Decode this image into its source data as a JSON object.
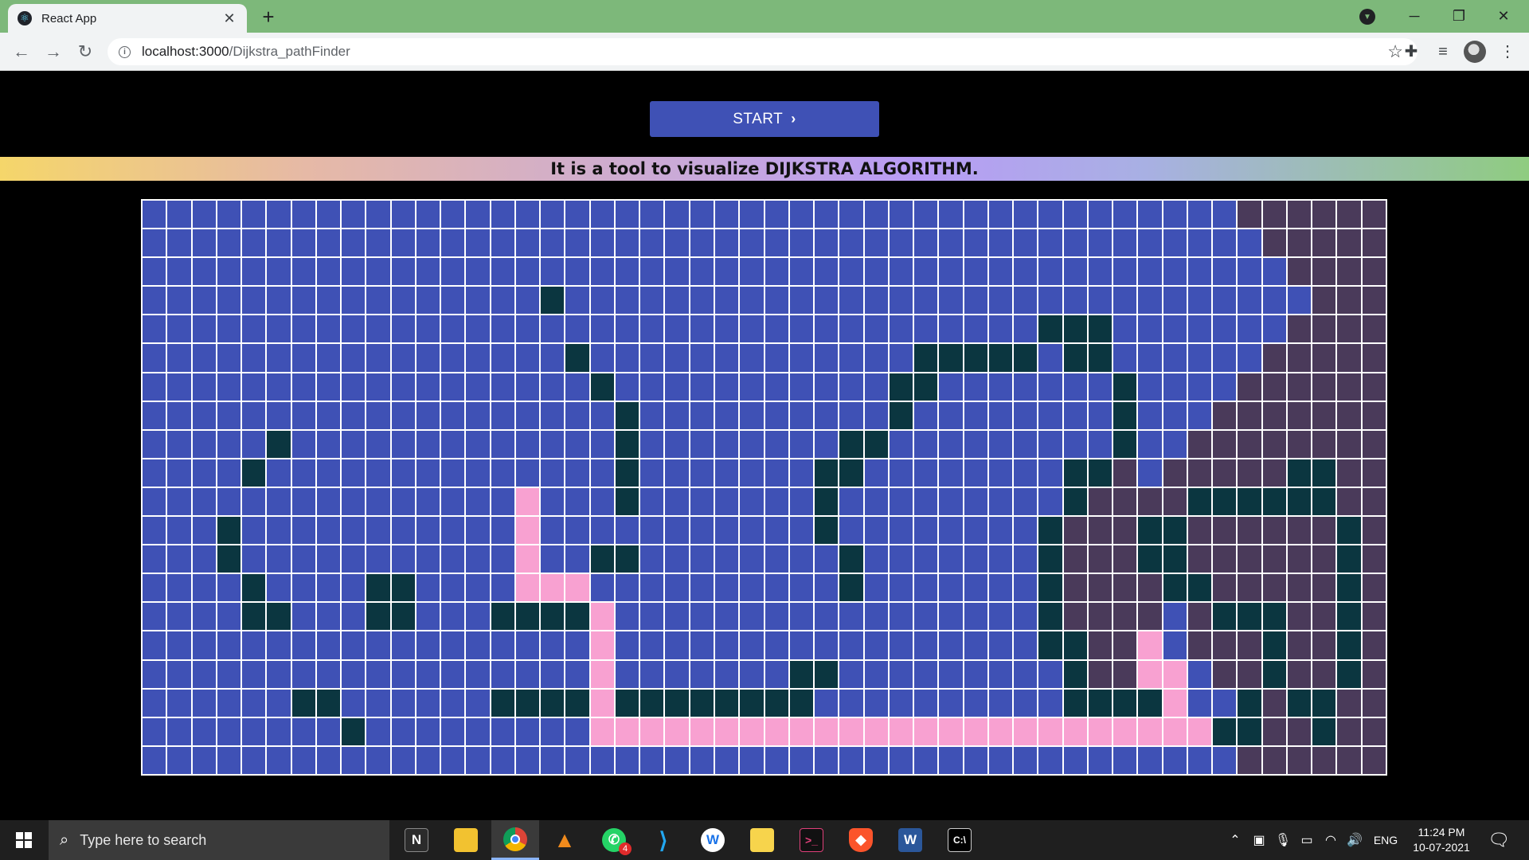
{
  "browser": {
    "tab_title": "React App",
    "url_host": "localhost:3000",
    "url_path": "/Dijkstra_pathFinder"
  },
  "page": {
    "start_label": "START",
    "banner": "It is a tool to visualize DIJKSTRA ALGORITHM."
  },
  "grid": {
    "cols": 50,
    "rows": 20,
    "legend": {
      "U": "unvisited",
      "W": "wall",
      "P": "shortest-path",
      "V": "visited"
    },
    "cells": [
      "UUUUUUUUUUUUUUUUUUUUUUUUUUUUUUUUUUUUUUUUUUUUVVVVVV",
      "UUUUUUUUUUUUUUUUUUUUUUUUUUUUUUUUUUUUUUUUUUUUUVVVVV",
      "UUUUUUUUUUUUUUUUUUUUUUUUUUUUUUUUUUUUUUUUUUUUUUVVVV",
      "UUUUUUUUUUUUUUUUWUUUUUUUUUUUUUUUUUUUUUUUUUUUUUUVVV",
      "UUUUUUUUUUUUUUUUUUUUUUUUUUUUUUUUUUUUWWWUUUUUUUVVVV",
      "UUUUUUUUUUUUUUUUUWUUUUUUUUUUUUUWWWWWUWWUUUUUUVVVVV",
      "UUUUUUUUUUUUUUUUUUWUUUUUUUUUUUWWUUUUUUUWUUUUVVVVVV",
      "UUUUUUUUUUUUUUUUUUUWUUUUUUUUUUWUUUUUUUUWUUUVVVVVVV",
      "UUUUUWUUUUUUUUUUUUUWUUUUUUUUWWUUUUUUUUUWUUVVVVVVVV",
      "UUUUWUUUUUUUUUUUUUUWUUUUUUUWWUUUUUUUUWWVUVVVVVWWVV",
      "UUUUUUUUUUUUUUUPUUUWUUUUUUUWUUUUUUUUUWVVVVWWWWWWVV",
      "UUUWUUUUUUUUUUUPUUUUUUUUUUUWUUUUUUUUWVVVWWVVVVVVWV",
      "UUUWUUUUUUUUUUUPUUWWUUUUUUUUWUUUUUUUWVVVWWVVVVVVWV",
      "UUUUWUUUUWWUUUUPPPUUUUUUUUUUWUUUUUUUWVVVVWWVVVVVWV",
      "UUUUWWUUUWWUUUWWWWPUUUUUUUUUUUUUUUUUWVVVVUVWWWVVWV",
      "UUUUUUUUUUUUUUUUUUPUUUUUUUUUUUUUUUUUWWVVPUVVVWVVWV",
      "UUUUUUUUUUUUUUUUUUPUUUUUUUWWUUUUUUUUUWVVPPUVVWVVWV",
      "UUUUUUWWUUUUUUWWWWPWWWWWWWWUUUUUUUUUUWWWWPUUWVWWVV",
      "UUUUUUUUWUUUUUUUUUPPPPPPPPPPPPPPPPPPPPPPPPPWWVVWVV",
      "UUUUUUUUUUUUUUUUUUUUUUUUUUUUUUUUUUUUUUUUUUUUVVVVVV"
    ]
  },
  "taskbar": {
    "search_placeholder": "Type here to search",
    "whatsapp_badge": "4",
    "language": "ENG",
    "time": "11:24 PM",
    "date": "10-07-2021"
  }
}
